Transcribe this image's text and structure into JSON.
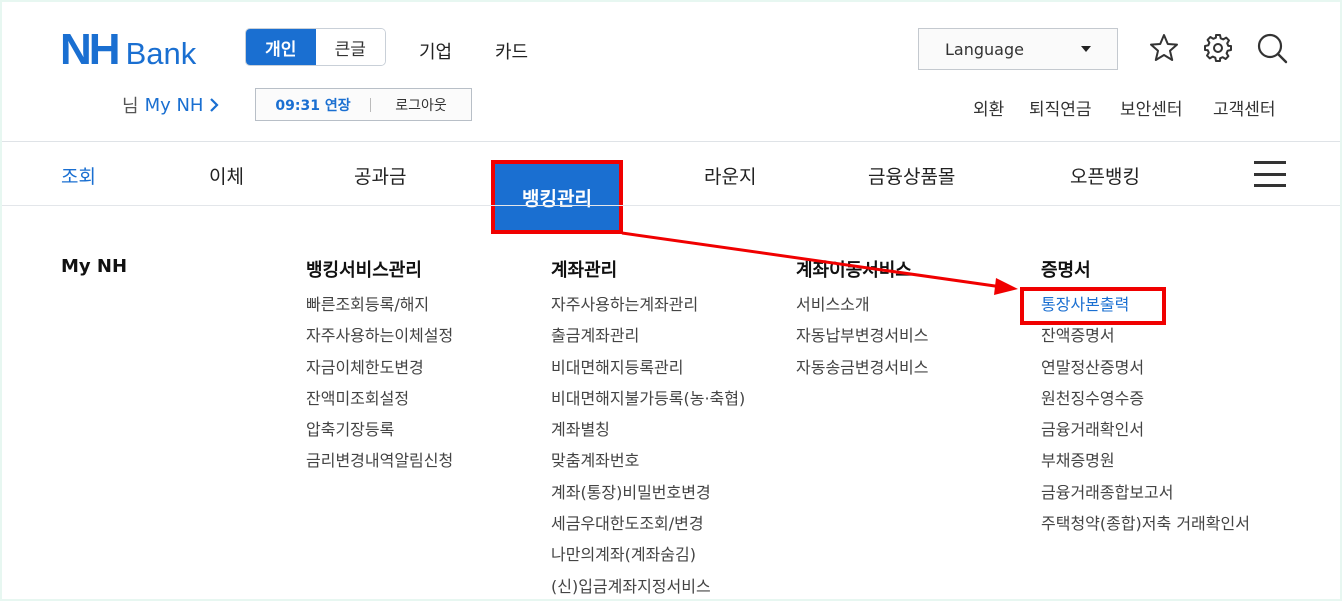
{
  "brand": {
    "nh": "NH",
    "bank": "Bank"
  },
  "mode": {
    "personal": "개인",
    "large_text": "큰글"
  },
  "top_links": [
    "기업",
    "카드"
  ],
  "language": {
    "label": "Language"
  },
  "icons": {
    "favorite": "star-icon",
    "settings": "gear-icon",
    "search": "search-icon"
  },
  "user": {
    "prefix": "님",
    "my_nh": "My NH"
  },
  "session": {
    "time": "09:31 연장",
    "logout": "로그아웃"
  },
  "util_links": [
    "외환",
    "퇴직연금",
    "보안센터",
    "고객센터"
  ],
  "gnb": [
    "조회",
    "이체",
    "공과금",
    "뱅킹관리",
    "라운지",
    "금융상품몰",
    "오픈뱅킹"
  ],
  "columns": {
    "my_nh": {
      "title": "My NH"
    },
    "banking_service": {
      "title": "뱅킹서비스관리",
      "items": [
        "빠른조회등록/해지",
        "자주사용하는이체설정",
        "자금이체한도변경",
        "잔액미조회설정",
        "압축기장등록",
        "금리변경내역알림신청"
      ]
    },
    "account_mgmt": {
      "title": "계좌관리",
      "items": [
        "자주사용하는계좌관리",
        "출금계좌관리",
        "비대면해지등록관리",
        "비대면해지불가등록(농·축협)",
        "계좌별칭",
        "맞춤계좌번호",
        "계좌(통장)비밀번호변경",
        "세금우대한도조회/변경",
        "나만의계좌(계좌숨김)",
        "(신)입금계좌지정서비스"
      ]
    },
    "account_transfer": {
      "title": "계좌이동서비스",
      "items": [
        "서비스소개",
        "자동납부변경서비스",
        "자동송금변경서비스"
      ]
    },
    "certificates": {
      "title": "증명서",
      "items": [
        "통장사본출력",
        "잔액증명서",
        "연말정산증명서",
        "원천징수영수증",
        "금융거래확인서",
        "부채증명원",
        "금융거래종합보고서",
        "주택청약(종합)저축 거래확인서"
      ]
    }
  },
  "colors": {
    "accent": "#1a6fd1",
    "highlight": "#f00000"
  }
}
